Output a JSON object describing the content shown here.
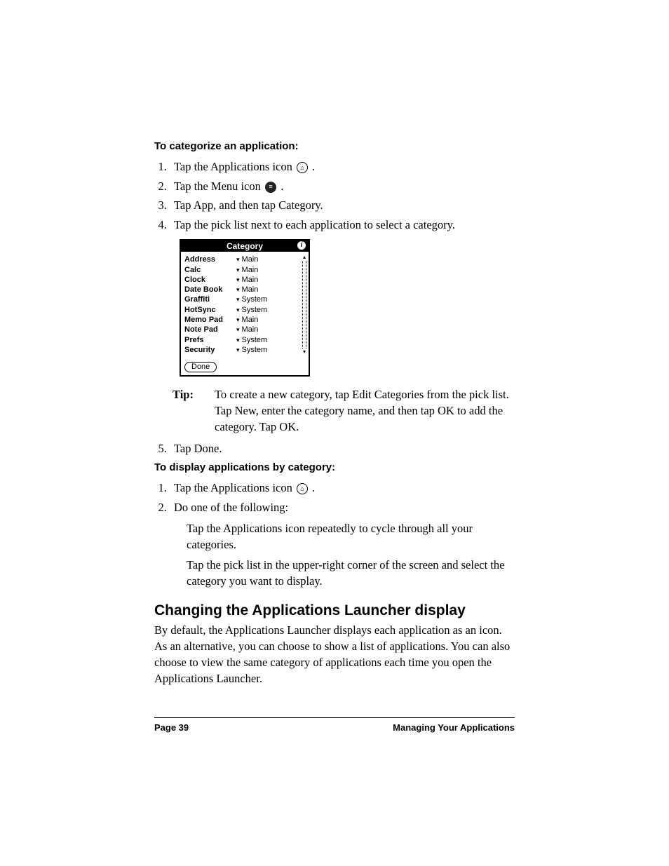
{
  "heading1": "To categorize an application:",
  "list1": {
    "i1a": "Tap the Applications icon ",
    "i1b": ".",
    "i2a": "Tap the Menu icon ",
    "i2b": ".",
    "i3": "Tap App, and then tap Category.",
    "i4": "Tap the pick list next to each application to select a category."
  },
  "screenshot": {
    "title": "Category",
    "apps": [
      "Address",
      "Calc",
      "Clock",
      "Date Book",
      "Graffiti",
      "HotSync",
      "Memo Pad",
      "Note Pad",
      "Prefs",
      "Security"
    ],
    "cats": [
      "Main",
      "Main",
      "Main",
      "Main",
      "System",
      "System",
      "Main",
      "Main",
      "System",
      "System"
    ],
    "done": "Done"
  },
  "tip": {
    "label": "Tip:",
    "text": "To create a new category, tap Edit Categories from the pick list. Tap New, enter the category name, and then tap OK to add the category. Tap OK."
  },
  "list1_5": "Tap Done.",
  "heading2": "To display applications by category:",
  "list2": {
    "i1a": "Tap the Applications icon ",
    "i1b": ".",
    "i2": "Do one of the following:"
  },
  "sub1": "Tap the Applications icon repeatedly to cycle through all your categories.",
  "sub2": "Tap the pick list in the upper-right corner of the screen and select the category you want to display.",
  "section": "Changing the Applications Launcher display",
  "body": "By default, the Applications Launcher displays each application as an icon. As an alternative, you can choose to show a list of applications. You can also choose to view the same category of applications each time you open the Applications Launcher.",
  "footer": {
    "left": "Page 39",
    "right": "Managing Your Applications"
  }
}
